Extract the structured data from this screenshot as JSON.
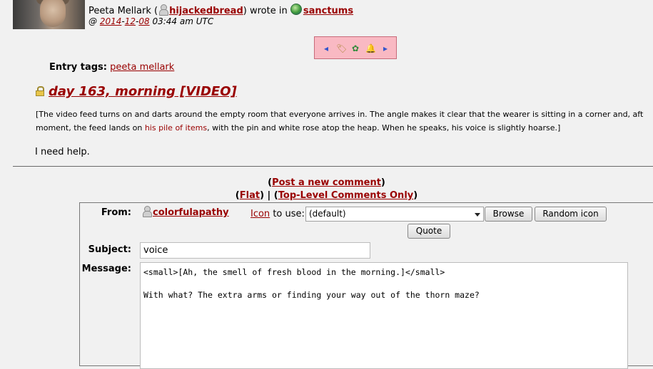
{
  "poster": {
    "name": "Peeta Mellark",
    "open_paren": "(",
    "username": "hijackedbread",
    "close_wrote": ") wrote in",
    "community": "sanctums",
    "date_prefix": "@",
    "year": "2014",
    "month": "12",
    "day": "08",
    "time": "03:44 am UTC"
  },
  "nav": {
    "prev": "◂",
    "tag": "🏷",
    "memory": "✿",
    "alert": "🔔",
    "next": "▸"
  },
  "tags": {
    "label": "Entry tags:",
    "value": "peeta mellark"
  },
  "entry": {
    "title": "day 163, morning [VIDEO]",
    "line1": "[The video feed turns on and darts around the empty room that everyone arrives in. The angle makes it clear that the wearer is sitting in a corner and, aft",
    "line2a": "moment, the feed lands on",
    "line2link": "his pile of items",
    "line2b": ", with the pin and white rose atop the heap. When he speaks, his voice is slightly hoarse.]",
    "speech": "I need help."
  },
  "comment_links": {
    "post_new": "Post a new comment",
    "flat": "Flat",
    "separator": "|",
    "top_level": "Top-Level Comments Only"
  },
  "form": {
    "from_label": "From:",
    "from_user": "colorfulapathy",
    "icon_link": "Icon",
    "icon_text": "to use:",
    "icon_selected": "(default)",
    "browse": "Browse",
    "random": "Random icon",
    "quote": "Quote",
    "subject_label": "Subject:",
    "subject_value": "voice",
    "message_label": "Message:",
    "message_line1": "<small>[Ah, the smell of fresh blood in the morning.]</small>",
    "message_line2": "",
    "message_line3": "With what? The extra arms or finding your way out of the thorn maze?"
  }
}
